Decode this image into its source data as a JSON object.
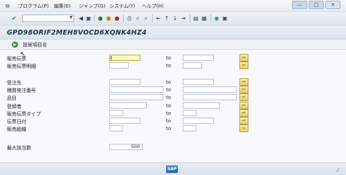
{
  "menu": {
    "items": [
      "プログラム(P)",
      "編集(E)",
      "ジャンプ(G)",
      "システム(Y)",
      "ヘルプ(H)"
    ],
    "window_buttons": [
      "—",
      "□",
      "✕"
    ]
  },
  "toolbar": {
    "icons": [
      "enter-icon",
      "save-icon",
      "back-icon",
      "exit-icon",
      "cancel-icon",
      "print-icon",
      "find-icon",
      "find-next-icon",
      "first-page-icon",
      "prev-page-icon",
      "next-page-icon",
      "last-page-icon",
      "new-session-icon",
      "shortcut-icon",
      "help-icon",
      "customize-icon"
    ]
  },
  "title": "GPD98ORIF2MEH8VOCD6XQNK4HZ4",
  "appbar": {
    "tech_label": "技術項目名"
  },
  "form": {
    "rows": [
      {
        "label": "販売伝票",
        "to": "to"
      },
      {
        "label": "販売伝票明細",
        "to": "to"
      },
      {
        "label": "受注先",
        "to": "to"
      },
      {
        "label": "積質発注番号",
        "to": "to"
      },
      {
        "label": "品目",
        "to": "to"
      },
      {
        "label": "登録者",
        "to": "to"
      },
      {
        "label": "販売伝票タイプ",
        "to": "to"
      },
      {
        "label": "伝票日付",
        "to": "to"
      },
      {
        "label": "販売組織",
        "to": "to"
      }
    ],
    "max_hits_label": "最大該当数",
    "max_hits_value": "500"
  },
  "footer": {
    "logo": "SAP"
  }
}
